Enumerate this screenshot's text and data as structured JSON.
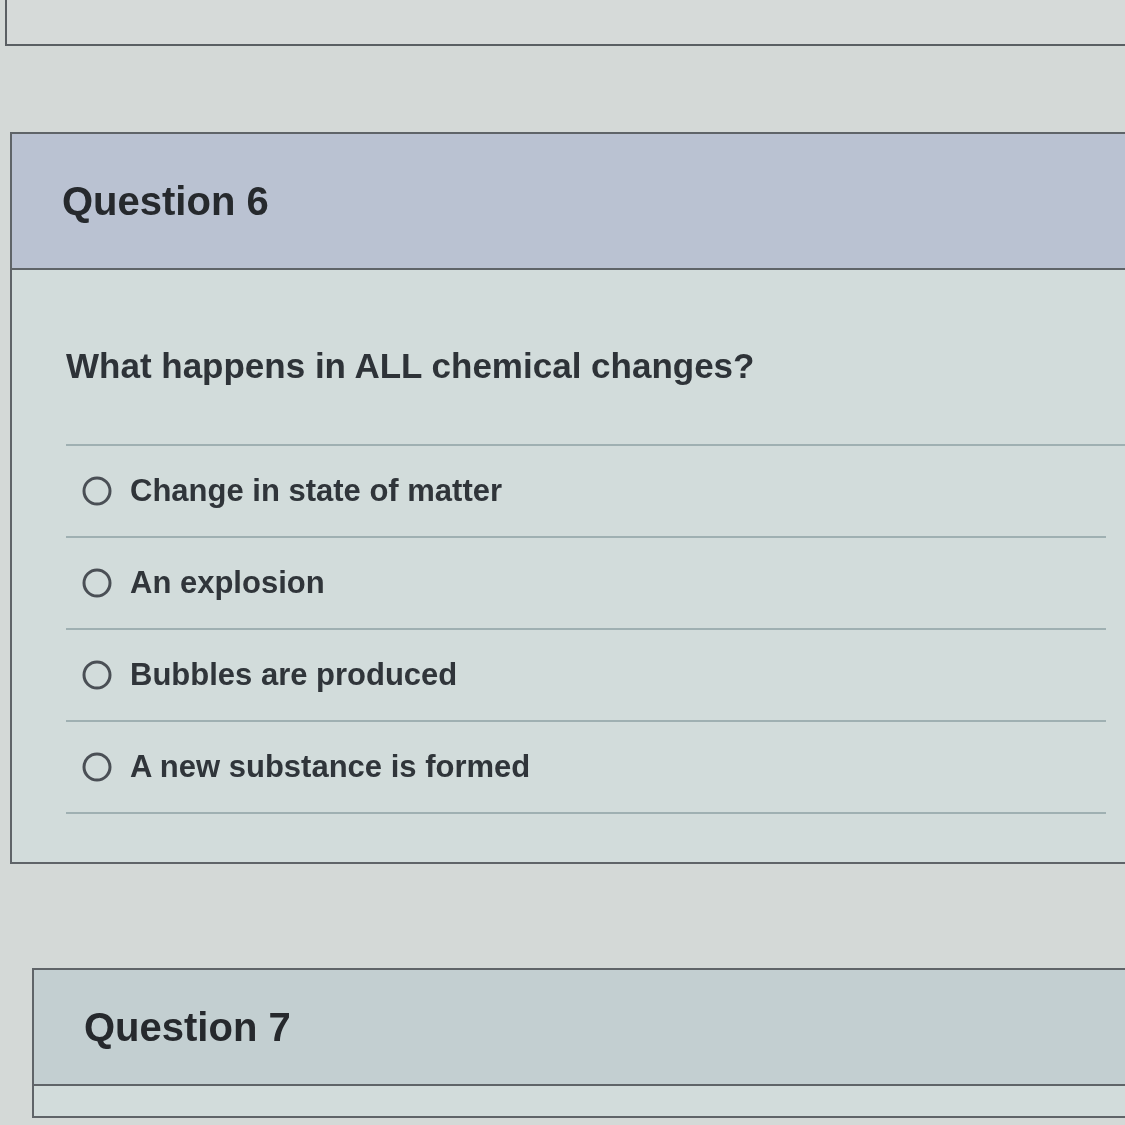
{
  "questions": [
    {
      "title": "Question 6",
      "prompt": "What happens in ALL chemical changes?",
      "answers": [
        {
          "label": "Change in state of matter",
          "selected": false
        },
        {
          "label": "An explosion",
          "selected": false
        },
        {
          "label": "Bubbles are produced",
          "selected": false
        },
        {
          "label": "A new substance is formed",
          "selected": false
        }
      ]
    },
    {
      "title": "Question 7"
    }
  ]
}
